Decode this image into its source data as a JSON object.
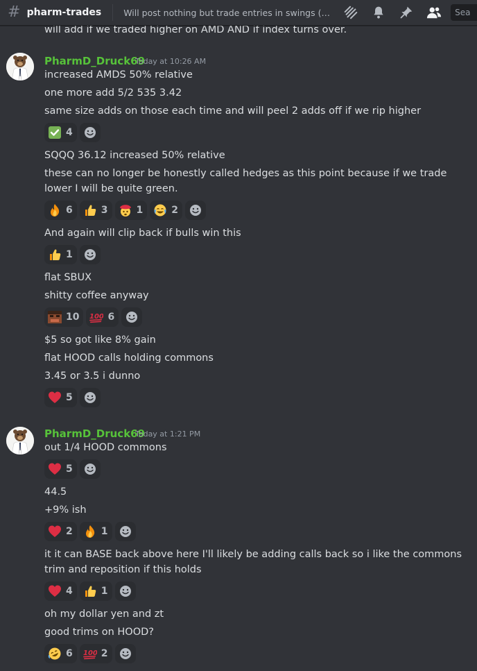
{
  "header": {
    "channel_name": "pharm-trades",
    "topic": "Will post nothing but trade entries in swings (for my...",
    "search_label": "Sea"
  },
  "clipped_line": "will add if we traded higher on AMD AND if index turns over.",
  "messages": [
    {
      "author": "PharmD_Druck69",
      "timestamp": "Today at 10:26 AM",
      "lines": [
        "increased AMDS 50% relative",
        "one more add 5/2 535 3.42",
        "same size adds on those each time and will peel 2 adds off if we rip higher"
      ],
      "reactions": [
        {
          "emoji": "white-check-mark",
          "count": "4"
        }
      ]
    },
    {
      "lines": [
        "SQQQ 36.12 increased 50% relative",
        "these can no longer be honestly called hedges as this point because if we trade",
        "lower I will be quite green."
      ],
      "reactions": [
        {
          "emoji": "fire",
          "count": "6"
        },
        {
          "emoji": "thumbs-up",
          "count": "3"
        },
        {
          "emoji": "exploding-head",
          "count": "1"
        },
        {
          "emoji": "joy",
          "count": "2"
        }
      ]
    },
    {
      "lines": [
        "And again will clip back if bulls win this"
      ],
      "reactions": [
        {
          "emoji": "thumbs-up",
          "count": "1"
        }
      ]
    },
    {
      "lines": [
        "flat SBUX",
        "shitty coffee anyway"
      ],
      "reactions": [
        {
          "emoji": "custom-face",
          "count": "10"
        },
        {
          "emoji": "hundred",
          "count": "6"
        }
      ]
    },
    {
      "lines": [
        "$5 so got like 8% gain",
        "flat HOOD calls holding commons",
        "3.45 or 3.5 i dunno"
      ],
      "reactions": [
        {
          "emoji": "heart",
          "count": "5"
        }
      ]
    },
    {
      "author": "PharmD_Druck69",
      "timestamp": "Today at 1:21 PM",
      "lines": [
        "out 1/4 HOOD commons"
      ],
      "reactions": [
        {
          "emoji": "heart",
          "count": "5"
        }
      ]
    },
    {
      "lines": [
        "44.5",
        "+9% ish"
      ],
      "reactions": [
        {
          "emoji": "heart",
          "count": "2"
        },
        {
          "emoji": "fire",
          "count": "1"
        }
      ]
    },
    {
      "lines": [
        "it it can BASE back above here I'll likely be adding calls back so i like the commons",
        "trim and reposition if this holds"
      ],
      "reactions": [
        {
          "emoji": "heart",
          "count": "4"
        },
        {
          "emoji": "thumbs-up",
          "count": "1"
        }
      ]
    },
    {
      "lines": [
        "oh my dollar yen and zt",
        "good trims on HOOD?"
      ],
      "reactions": [
        {
          "emoji": "rofl",
          "count": "6"
        },
        {
          "emoji": "hundred",
          "count": "2"
        }
      ]
    }
  ],
  "colors": {
    "background": "#313338",
    "author": "#57c23a",
    "reaction_bg": "#2b2d31"
  }
}
